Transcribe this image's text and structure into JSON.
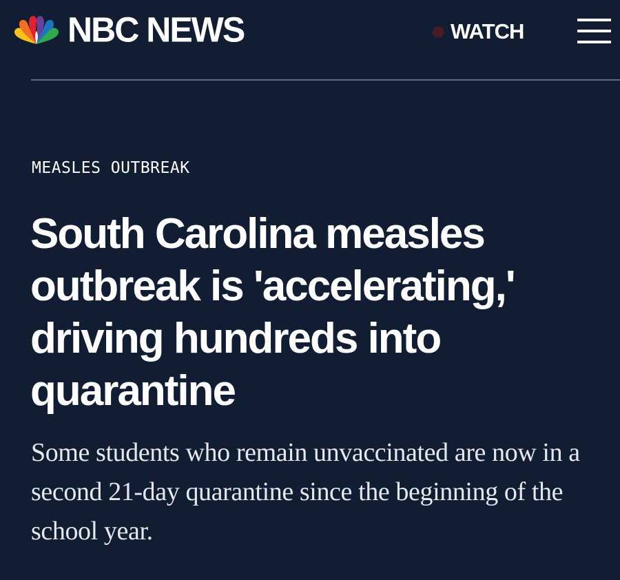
{
  "header": {
    "logo_text": "NBC NEWS",
    "logo_icon": "nbc-peacock-icon",
    "watch_label": "WATCH",
    "live_indicator_color": "#4a1a26",
    "menu_icon": "hamburger-menu-icon"
  },
  "article": {
    "kicker": "MEASLES OUTBREAK",
    "headline": "South Carolina measles outbreak is 'accelerating,' driving hundreds into quarantine",
    "dek": "Some students who remain unvaccinated are now in a second 21-day quarantine since the beginning of the school year."
  },
  "colors": {
    "background": "#111d33",
    "text": "#ffffff",
    "divider": "#5d6a84",
    "peacock": [
      "#f6c21b",
      "#f37021",
      "#e1232e",
      "#6e3f98",
      "#1e73be",
      "#2ea94b"
    ]
  }
}
